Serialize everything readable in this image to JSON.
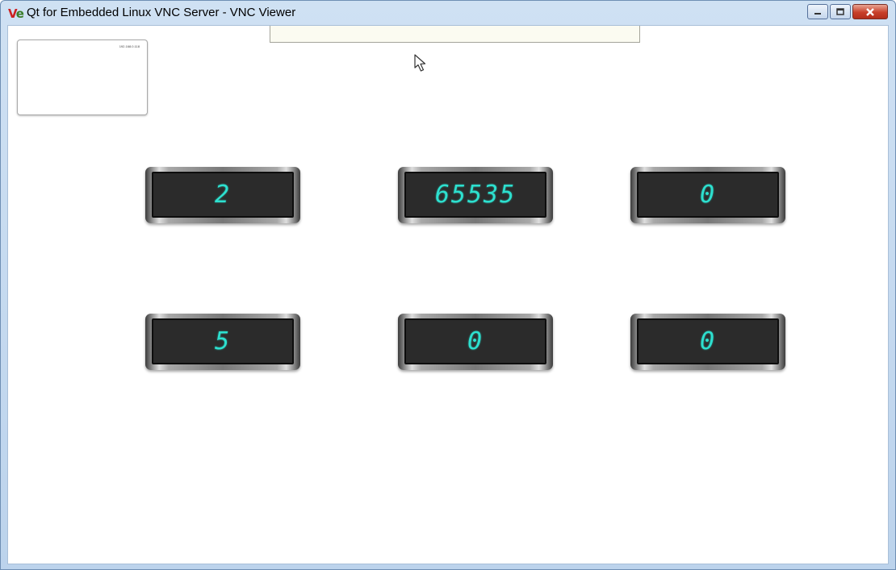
{
  "window": {
    "title": "Qt for Embedded Linux VNC Server - VNC Viewer",
    "icon": "vnc-viewer-logo",
    "icon_text": {
      "v": "V",
      "e": "e"
    },
    "controls": [
      "minimize-icon",
      "maximize-icon",
      "close-icon"
    ]
  },
  "thumbnail": {
    "ip": "192.168.0.118"
  },
  "displays": [
    "2",
    "65535",
    "0",
    "5",
    "0",
    "0"
  ],
  "colors": {
    "lcd_text": "#2de0cf",
    "lcd_background": "#2b2b2b",
    "frame": "#bcd3ec",
    "close_button": "#c8402a"
  }
}
